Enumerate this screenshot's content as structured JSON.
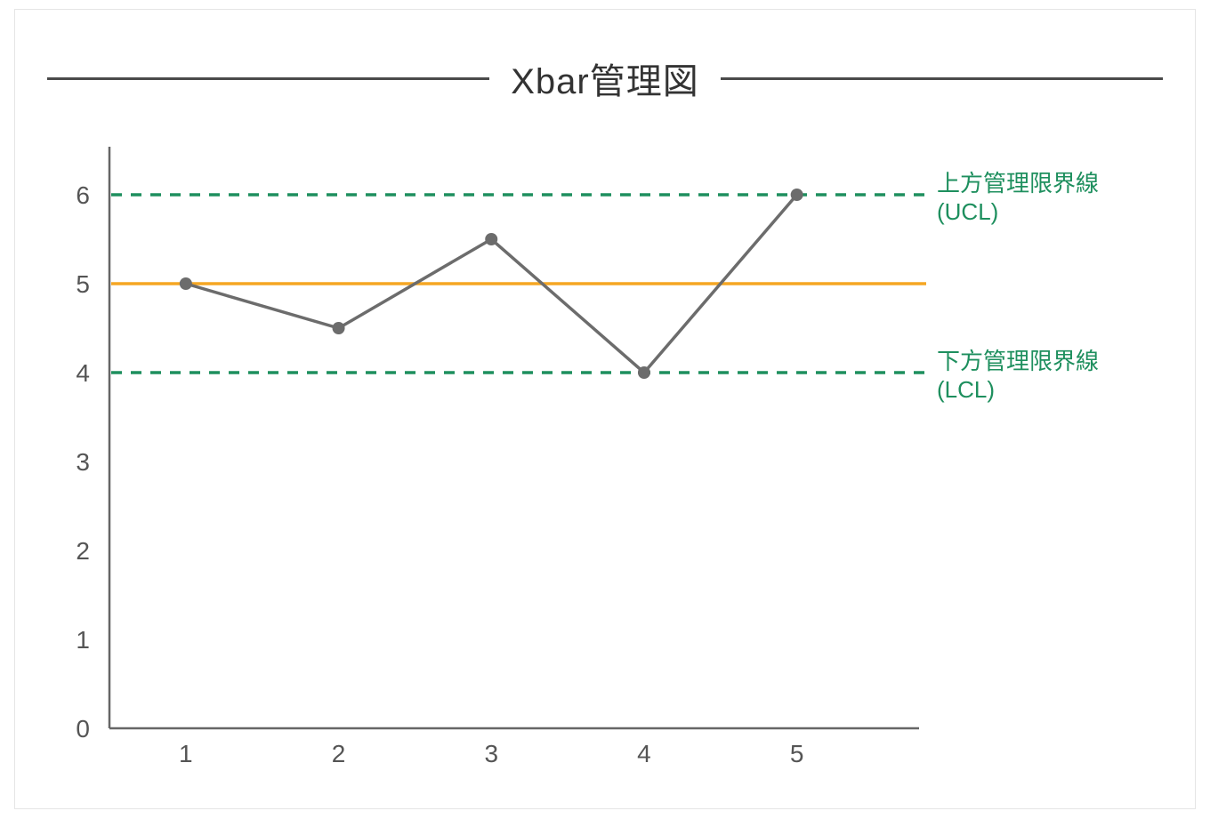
{
  "title": "Xbar管理図",
  "labels": {
    "ucl_line1": "上方管理限界線",
    "ucl_line2": "(UCL)",
    "lcl_line1": "下方管理限界線",
    "lcl_line2": "(LCL)"
  },
  "y_ticks": [
    "0",
    "1",
    "2",
    "3",
    "4",
    "5",
    "6"
  ],
  "x_ticks": [
    "1",
    "2",
    "3",
    "4",
    "5"
  ],
  "chart_data": {
    "type": "line",
    "title": "Xbar管理図",
    "categories": [
      1,
      2,
      3,
      4,
      5
    ],
    "values": [
      5.0,
      4.5,
      5.5,
      4.0,
      6.0
    ],
    "center_line": 5.0,
    "ucl": 6.0,
    "lcl": 4.0,
    "xlabel": "",
    "ylabel": "",
    "ylim": [
      0,
      6.5
    ],
    "xlim": [
      0.5,
      5.8
    ]
  }
}
